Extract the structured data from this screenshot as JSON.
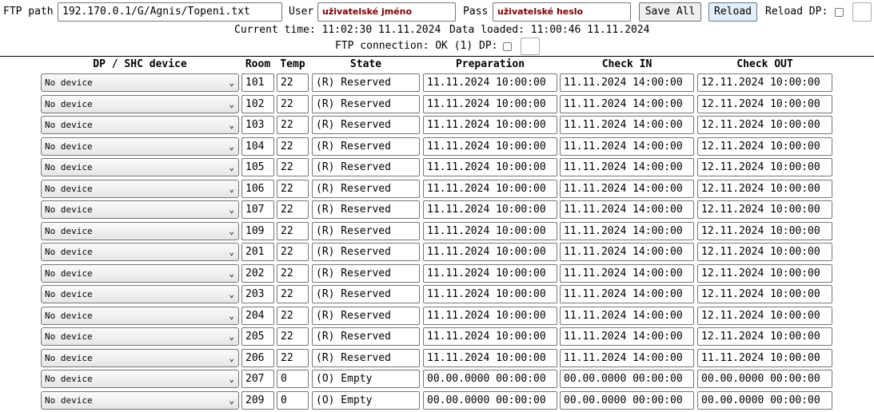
{
  "header": {
    "ftp_path_label": "FTP path",
    "ftp_path_value": "192.170.0.1/G/Agnis/Topeni.txt",
    "user_label": "User",
    "user_value": "uživatelské jméno",
    "pass_label": "Pass",
    "pass_value": "uživatelské heslo",
    "save_all_label": "Save All",
    "reload_label": "Reload",
    "reload_dp_label": "Reload DP:",
    "current_time_text": "Current time: 11:02:30 11.11.2024",
    "data_loaded_text": "Data loaded: 11:00:46 11.11.2024",
    "ftp_connection_text": "FTP connection: OK (1) DP:"
  },
  "table": {
    "columns": [
      "DP / SHC device",
      "Room",
      "Temp",
      "State",
      "Preparation",
      "Check IN",
      "Check OUT"
    ],
    "rows": [
      {
        "device": "No device",
        "room": "101",
        "temp": "22",
        "state": "(R) Reserved",
        "prep": "11.11.2024 10:00:00",
        "in": "11.11.2024 14:00:00",
        "out": "12.11.2024 10:00:00"
      },
      {
        "device": "No device",
        "room": "102",
        "temp": "22",
        "state": "(R) Reserved",
        "prep": "11.11.2024 10:00:00",
        "in": "11.11.2024 14:00:00",
        "out": "12.11.2024 10:00:00"
      },
      {
        "device": "No device",
        "room": "103",
        "temp": "22",
        "state": "(R) Reserved",
        "prep": "11.11.2024 10:00:00",
        "in": "11.11.2024 14:00:00",
        "out": "12.11.2024 10:00:00"
      },
      {
        "device": "No device",
        "room": "104",
        "temp": "22",
        "state": "(R) Reserved",
        "prep": "11.11.2024 10:00:00",
        "in": "11.11.2024 14:00:00",
        "out": "12.11.2024 10:00:00"
      },
      {
        "device": "No device",
        "room": "105",
        "temp": "22",
        "state": "(R) Reserved",
        "prep": "11.11.2024 10:00:00",
        "in": "11.11.2024 14:00:00",
        "out": "12.11.2024 10:00:00"
      },
      {
        "device": "No device",
        "room": "106",
        "temp": "22",
        "state": "(R) Reserved",
        "prep": "11.11.2024 10:00:00",
        "in": "11.11.2024 14:00:00",
        "out": "12.11.2024 10:00:00"
      },
      {
        "device": "No device",
        "room": "107",
        "temp": "22",
        "state": "(R) Reserved",
        "prep": "11.11.2024 10:00:00",
        "in": "11.11.2024 14:00:00",
        "out": "12.11.2024 10:00:00"
      },
      {
        "device": "No device",
        "room": "109",
        "temp": "22",
        "state": "(R) Reserved",
        "prep": "11.11.2024 10:00:00",
        "in": "11.11.2024 14:00:00",
        "out": "12.11.2024 10:00:00"
      },
      {
        "device": "No device",
        "room": "201",
        "temp": "22",
        "state": "(R) Reserved",
        "prep": "11.11.2024 10:00:00",
        "in": "11.11.2024 14:00:00",
        "out": "12.11.2024 10:00:00"
      },
      {
        "device": "No device",
        "room": "202",
        "temp": "22",
        "state": "(R) Reserved",
        "prep": "11.11.2024 10:00:00",
        "in": "11.11.2024 14:00:00",
        "out": "12.11.2024 10:00:00"
      },
      {
        "device": "No device",
        "room": "203",
        "temp": "22",
        "state": "(R) Reserved",
        "prep": "11.11.2024 10:00:00",
        "in": "11.11.2024 14:00:00",
        "out": "12.11.2024 10:00:00"
      },
      {
        "device": "No device",
        "room": "204",
        "temp": "22",
        "state": "(R) Reserved",
        "prep": "11.11.2024 10:00:00",
        "in": "11.11.2024 14:00:00",
        "out": "12.11.2024 10:00:00"
      },
      {
        "device": "No device",
        "room": "205",
        "temp": "22",
        "state": "(R) Reserved",
        "prep": "11.11.2024 10:00:00",
        "in": "11.11.2024 14:00:00",
        "out": "12.11.2024 10:00:00"
      },
      {
        "device": "No device",
        "room": "206",
        "temp": "22",
        "state": "(R) Reserved",
        "prep": "11.11.2024 10:00:00",
        "in": "11.11.2024 14:00:00",
        "out": "11.11.2024 10:00:00"
      },
      {
        "device": "No device",
        "room": "207",
        "temp": "0",
        "state": "(O) Empty",
        "prep": "00.00.0000 00:00:00",
        "in": "00.00.0000 00:00:00",
        "out": "00.00.0000 00:00:00"
      },
      {
        "device": "No device",
        "room": "209",
        "temp": "0",
        "state": "(O) Empty",
        "prep": "00.00.0000 00:00:00",
        "in": "00.00.0000 00:00:00",
        "out": "00.00.0000 00:00:00"
      }
    ]
  }
}
